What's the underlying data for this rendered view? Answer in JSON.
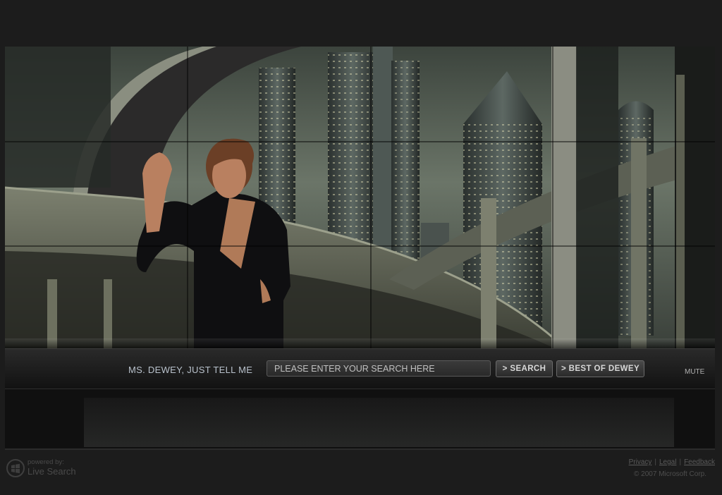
{
  "search_bar": {
    "prompt_label": "MS. DEWEY,  JUST TELL ME",
    "input_placeholder": "PLEASE ENTER YOUR SEARCH HERE",
    "input_value": "",
    "search_button": "> SEARCH",
    "best_of_button": "> BEST OF DEWEY",
    "mute_label": "MUTE"
  },
  "footer": {
    "powered_by": "powered by:",
    "brand": "Live Search",
    "links": [
      "Privacy",
      "Legal",
      "Feedback"
    ],
    "copyright": "© 2007 Microsoft Corp."
  },
  "icons": {
    "brand_logo": "live-search-logo-icon"
  },
  "colors": {
    "page_background": "#1c1c1c",
    "label_text": "#b9c2cc",
    "button_text": "#d8d8d8",
    "footer_text": "#4e4e4e"
  }
}
